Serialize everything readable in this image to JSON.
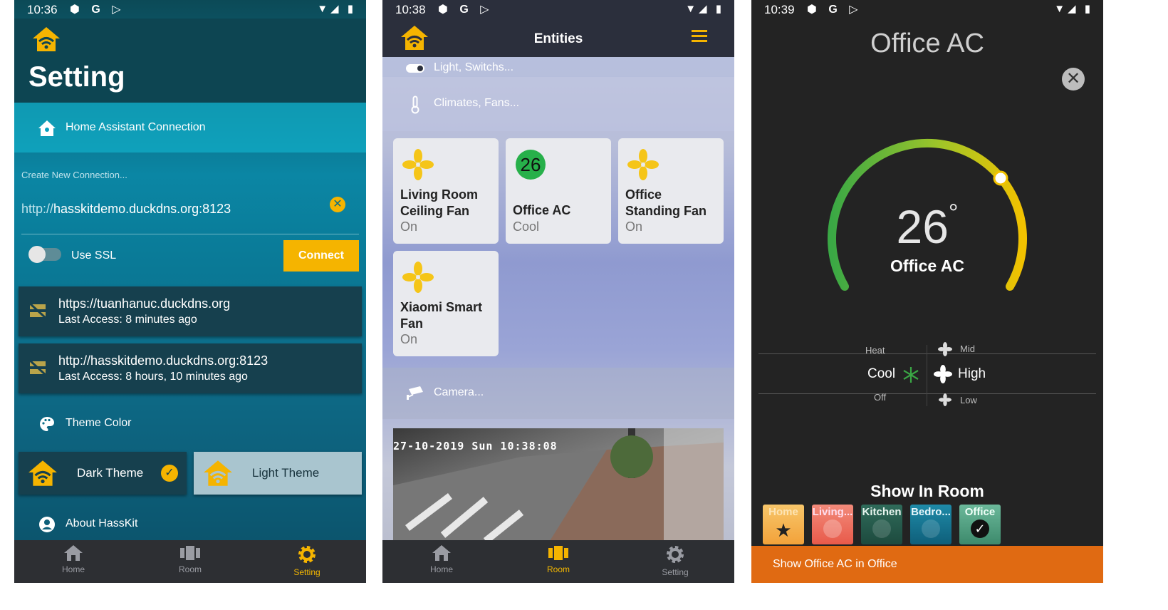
{
  "screen1": {
    "status_time": "10:36",
    "title": "Setting",
    "connection_row": "Home Assistant Connection",
    "create_label": "Create New Connection...",
    "url_protocol": "http://",
    "url_host": "hasskitdemo.duckdns.org:8123",
    "ssl_label": "Use SSL",
    "connect_label": "Connect",
    "connections": [
      {
        "url": "https://tuanhanuc.duckdns.org",
        "access": "Last Access: 8 minutes ago"
      },
      {
        "url": "http://hasskitdemo.duckdns.org:8123",
        "access": "Last Access: 8 hours, 10 minutes ago"
      }
    ],
    "theme_color_label": "Theme Color",
    "dark_theme": "Dark Theme",
    "light_theme": "Light Theme",
    "about_label": "About HassKit",
    "nav": [
      "Home",
      "Room",
      "Setting"
    ]
  },
  "screen2": {
    "status_time": "10:38",
    "title": "Entities",
    "section_lights": "Light, Switchs...",
    "section_climates": "Climates, Fans...",
    "tiles": [
      {
        "name_line1": "Living Room",
        "name_line2": "Ceiling Fan",
        "state": "On"
      },
      {
        "badge": "26",
        "name_line1": "Office AC",
        "name_line2": "",
        "state": "Cool"
      },
      {
        "name_line1": "Office",
        "name_line2": "Standing Fan",
        "state": "On"
      },
      {
        "name_line1": "Xiaomi Smart",
        "name_line2": "Fan",
        "state": "On"
      }
    ],
    "section_camera": "Camera...",
    "camera_timestamp": "27-10-2019 Sun 10:38:08",
    "nav": [
      "Home",
      "Room",
      "Setting"
    ]
  },
  "screen3": {
    "status_time": "10:39",
    "title": "Office AC",
    "temperature": "26",
    "degree": "°",
    "device_name": "Office AC",
    "mode_above": "Heat",
    "mode_selected": "Cool",
    "mode_below": "Off",
    "fan_above": "Mid",
    "fan_selected": "High",
    "fan_below": "Low",
    "show_in_room": "Show In Room",
    "rooms": [
      "Home",
      "Living...",
      "Kitchen",
      "Bedro...",
      "Office"
    ],
    "footer": "Show Office AC  in Office"
  },
  "colors": {
    "accent": "#f5b400",
    "footer": "#e06a12",
    "dial_green": "#3aa845",
    "dial_yellow": "#f2c200"
  }
}
